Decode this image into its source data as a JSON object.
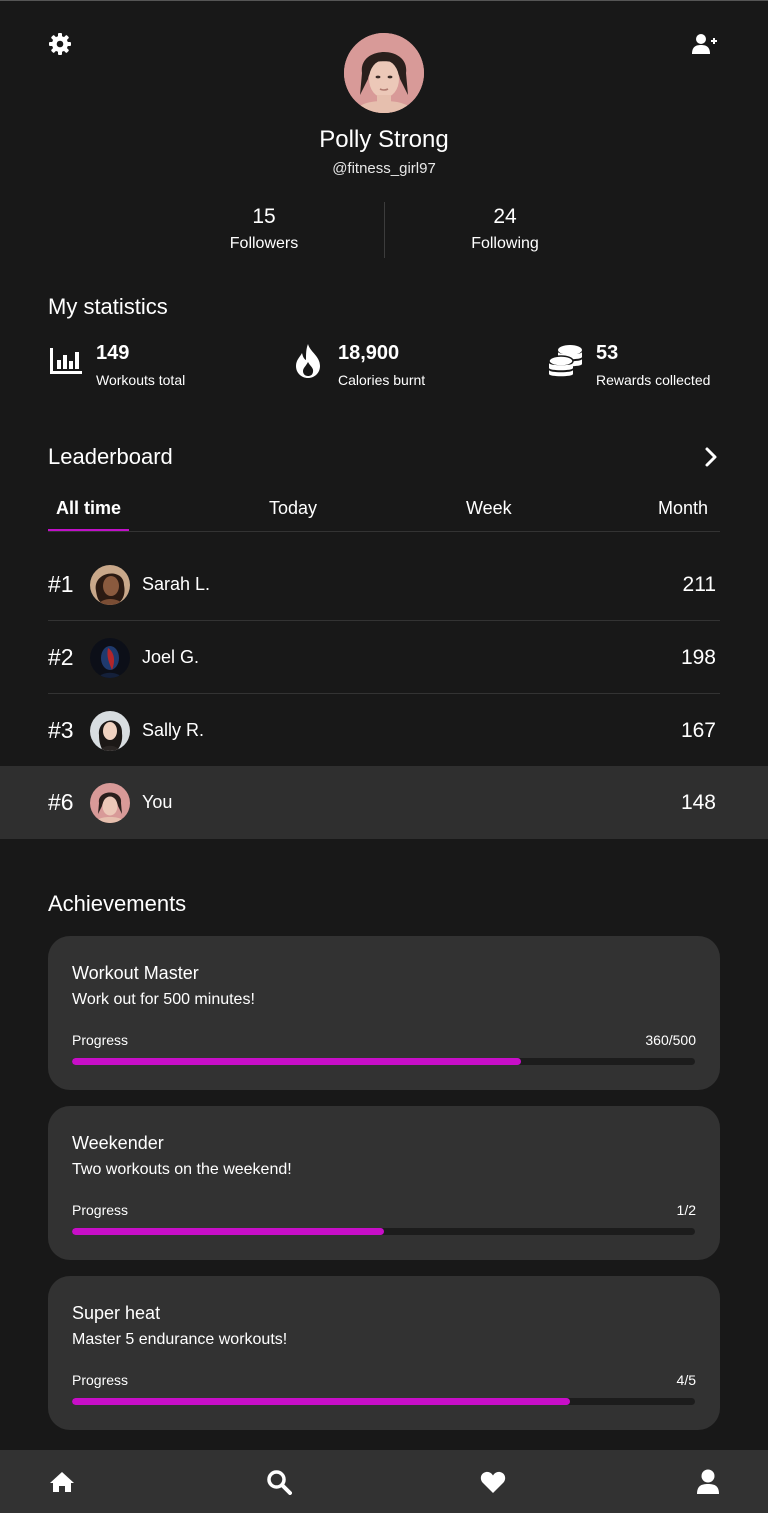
{
  "profile": {
    "name": "Polly Strong",
    "handle": "@fitness_girl97",
    "followers_count": "15",
    "followers_label": "Followers",
    "following_count": "24",
    "following_label": "Following"
  },
  "icons": {
    "settings": "gear-icon",
    "add_friend": "user-plus-icon"
  },
  "statistics": {
    "title": "My statistics",
    "items": [
      {
        "icon": "bar-chart-icon",
        "value": "149",
        "label": "Workouts total"
      },
      {
        "icon": "flame-icon",
        "value": "18,900",
        "label": "Calories burnt"
      },
      {
        "icon": "coins-icon",
        "value": "53",
        "label": "Rewards collected"
      }
    ]
  },
  "leaderboard": {
    "title": "Leaderboard",
    "tabs": [
      "All time",
      "Today",
      "Week",
      "Month"
    ],
    "active_tab": "All time",
    "rows": [
      {
        "rank": "#1",
        "name": "Sarah L.",
        "score": "211"
      },
      {
        "rank": "#2",
        "name": "Joel G.",
        "score": "198"
      },
      {
        "rank": "#3",
        "name": "Sally R.",
        "score": "167"
      },
      {
        "rank": "#6",
        "name": "You",
        "score": "148"
      }
    ]
  },
  "achievements": {
    "title": "Achievements",
    "progress_label": "Progress",
    "items": [
      {
        "title": "Workout Master",
        "description": "Work out for 500 minutes!",
        "progress_text": "360/500",
        "progress": 0.72
      },
      {
        "title": "Weekender",
        "description": "Two workouts on the weekend!",
        "progress_text": "1/2",
        "progress": 0.5
      },
      {
        "title": "Super heat",
        "description": "Master 5 endurance workouts!",
        "progress_text": "4/5",
        "progress": 0.8
      }
    ]
  },
  "bottom_nav": {
    "items": [
      "home-icon",
      "search-icon",
      "heart-icon",
      "user-icon"
    ]
  },
  "colors": {
    "background": "#181818",
    "card": "#323232",
    "accent": "#c80ec8"
  }
}
